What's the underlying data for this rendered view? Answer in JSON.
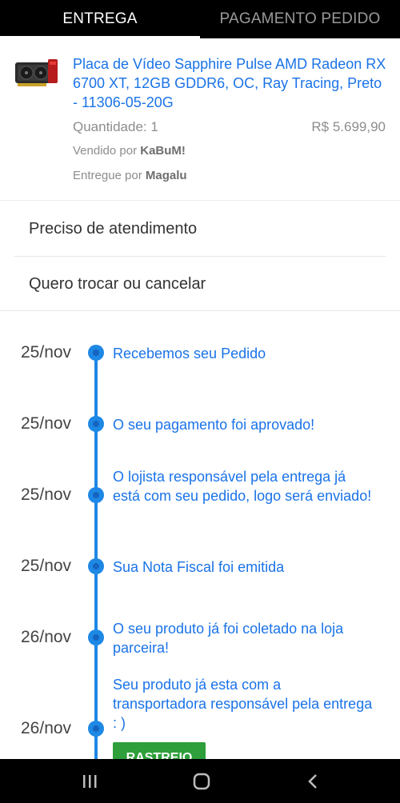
{
  "tabs": [
    {
      "label": "ENTREGA",
      "active": true
    },
    {
      "label": "PAGAMENTO PEDIDO",
      "active": false
    }
  ],
  "product": {
    "image_icon": "graphics-card-image",
    "title": "Placa de Vídeo Sapphire Pulse AMD Radeon RX 6700 XT, 12GB GDDR6, OC, Ray Tracing, Preto - 11306-05-20G",
    "quantity": "Quantidade: 1",
    "price": "R$ 5.699,90",
    "sold_by_label": "Vendido por",
    "sold_by": "KaBuM!",
    "delivered_by_label": "Entregue por",
    "delivered_by": "Magalu"
  },
  "options": [
    {
      "label": "Preciso de atendimento"
    },
    {
      "label": "Quero trocar ou cancelar"
    }
  ],
  "timeline": [
    {
      "date": "25/nov",
      "text": "Recebemos seu Pedido"
    },
    {
      "date": "25/nov",
      "text": "O seu pagamento foi aprovado!"
    },
    {
      "date": "25/nov",
      "text": "O lojista responsável pela entrega já está com seu pedido, logo será enviado!"
    },
    {
      "date": "25/nov",
      "text": "Sua Nota Fiscal foi emitida"
    },
    {
      "date": "26/nov",
      "text": "O seu produto já foi coletado na loja parceira!"
    },
    {
      "date": "26/nov",
      "text": "Seu produto já esta com a transportadora responsável pela entrega : )"
    }
  ],
  "track_button": {
    "label": "RASTREIO"
  },
  "colors": {
    "accent": "#1e88e5",
    "link": "#1a73e8",
    "track": "#2e9f3a"
  },
  "navbar": {
    "recents_icon": "recents-icon",
    "home_icon": "home-icon",
    "back_icon": "back-icon"
  }
}
